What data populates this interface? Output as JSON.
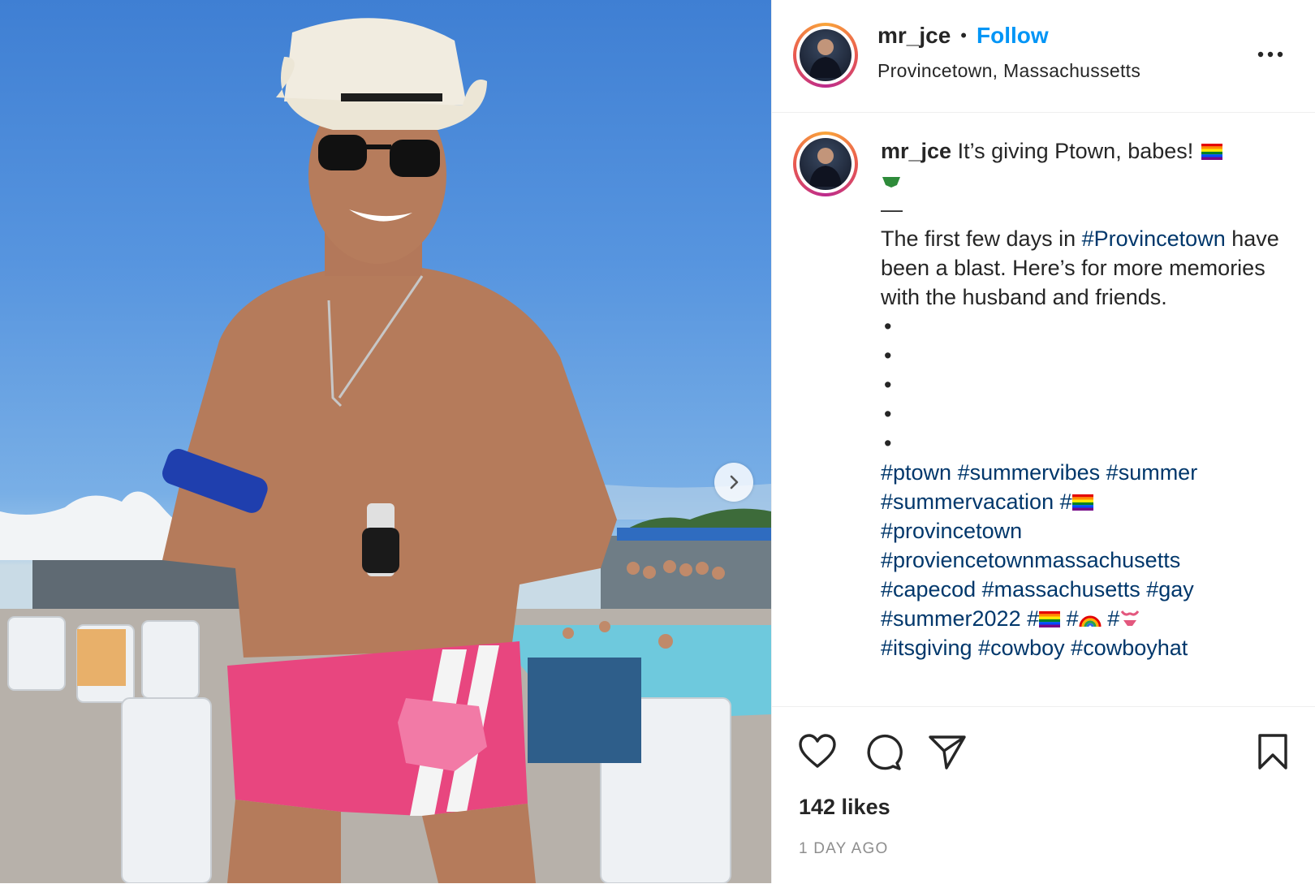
{
  "post": {
    "username": "mr_jce",
    "separator": "•",
    "follow_label": "Follow",
    "location": "Provincetown, Massachussetts",
    "more_icon": "more-horizontal-icon"
  },
  "caption": {
    "username": "mr_jce",
    "line1": "It’s giving Ptown, babes!",
    "dash": "—",
    "body_pre": "The first few days in",
    "body_tag": "#Provincetown",
    "body_post": "have been a blast. Here’s for more memories with the husband and friends.",
    "bullets": [
      "•",
      "•",
      "•",
      "•",
      "•"
    ],
    "hashtags_a": [
      "#ptown",
      "#summervibes",
      "#summer",
      "#summervacation"
    ],
    "hash_flag1": "#",
    "hashtags_b": [
      "#provincetown",
      "#proviencetownmassachusetts",
      "#capecod",
      "#massachusetts",
      "#gay",
      "#summer2022"
    ],
    "hash_flag2": "#",
    "hash_rainbow": "#",
    "hash_bikini": "#",
    "hashtags_c": [
      "#itsgiving",
      "#cowboy",
      "#cowboyhat"
    ]
  },
  "engagement": {
    "likes": "142 likes",
    "time_ago": "1 DAY AGO"
  },
  "colors": {
    "accent": "#0095f6",
    "hashtag": "#00376b",
    "text": "#262626",
    "muted": "#8e8e8e"
  },
  "icons": [
    "heart-icon",
    "comment-icon",
    "share-icon",
    "bookmark-icon",
    "chevron-right-icon"
  ]
}
